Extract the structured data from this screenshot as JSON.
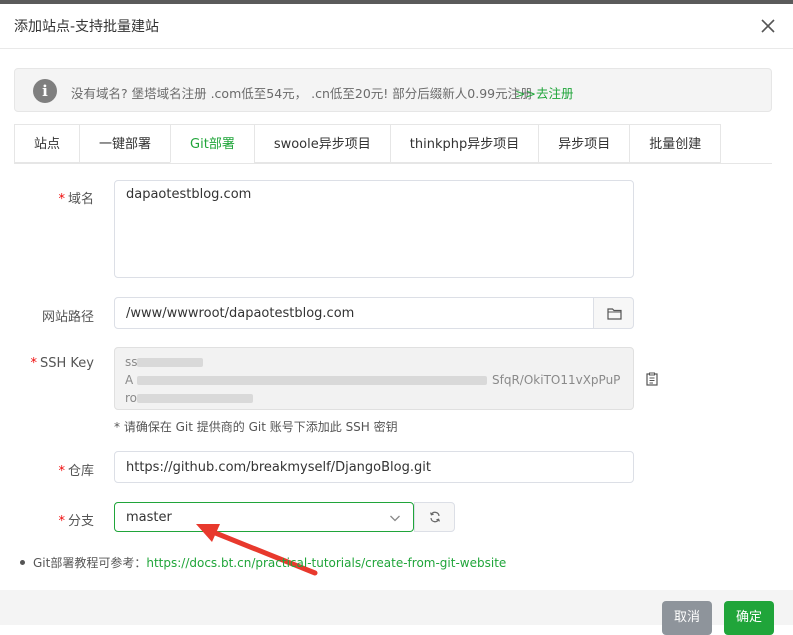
{
  "dialog": {
    "title": "添加站点-支持批量建站"
  },
  "notice": {
    "text": "没有域名? 堡塔域名注册 .com低至54元，  .cn低至20元! 部分后缀新人0.99元注册",
    "link": ">>去注册"
  },
  "tabs": [
    {
      "label": "站点",
      "active": false
    },
    {
      "label": "一键部署",
      "active": false
    },
    {
      "label": "Git部署",
      "active": true
    },
    {
      "label": "swoole异步项目",
      "active": false
    },
    {
      "label": "thinkphp异步项目",
      "active": false
    },
    {
      "label": "异步项目",
      "active": false
    },
    {
      "label": "批量创建",
      "active": false
    }
  ],
  "form": {
    "domain": {
      "label": "域名",
      "value": "dapaotestblog.com"
    },
    "path": {
      "label": "网站路径",
      "value": "/www/wwwroot/dapaotestblog.com"
    },
    "ssh": {
      "label": "SSH Key",
      "line1": "ss",
      "line2_start": "A",
      "line2_end": "SfqR/OkiTO11vXpPuP",
      "line3": "ro",
      "hint": "* 请确保在 Git 提供商的 Git 账号下添加此 SSH 密钥"
    },
    "repo": {
      "label": "仓库",
      "value": "https://github.com/breakmyself/DjangoBlog.git"
    },
    "branch": {
      "label": "分支",
      "value": "master"
    }
  },
  "tutorial": {
    "text": "Git部署教程可参考：",
    "link": "https://docs.bt.cn/practical-tutorials/create-from-git-website"
  },
  "footer": {
    "cancel": "取消",
    "ok": "确定"
  },
  "colors": {
    "accent": "#20a53a",
    "required": "#ef0808",
    "annotation_arrow": "#e8392d"
  }
}
